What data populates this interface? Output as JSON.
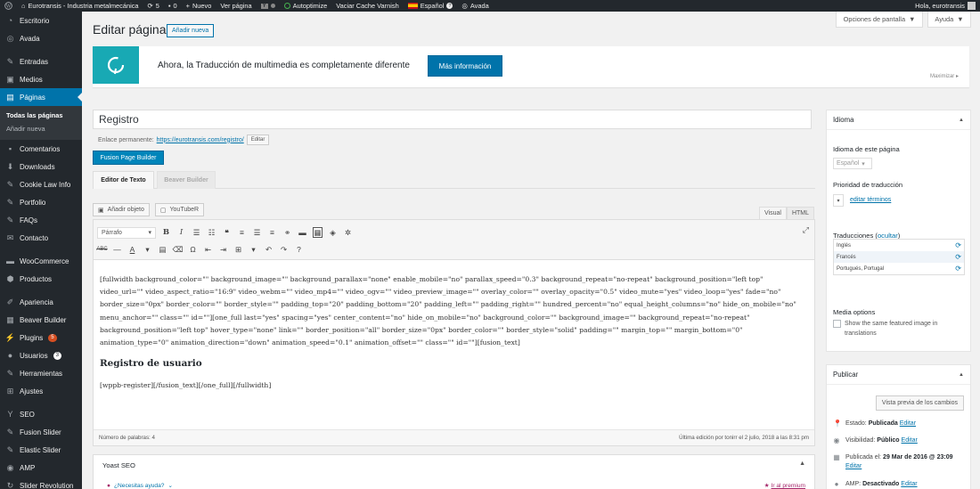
{
  "admin_bar": {
    "site_name": "Eurotransis - Industria metalmecánica",
    "updates_count": "5",
    "comments_count": "0",
    "new_label": "Nuevo",
    "view_page_label": "Ver página",
    "autoptimize_label": "Autoptimize",
    "varnish_label": "Vaciar Cache Varnish",
    "language_label": "Español",
    "avada_label": "Avada",
    "greeting": "Hola, eurotransis"
  },
  "sidebar": {
    "items": [
      {
        "label": "Escritorio",
        "icon": "dashboard-icon"
      },
      {
        "label": "Avada",
        "icon": "avada-icon"
      },
      {
        "label": "Entradas",
        "icon": "pin-icon"
      },
      {
        "label": "Medios",
        "icon": "media-icon"
      },
      {
        "label": "Páginas",
        "icon": "pages-icon"
      },
      {
        "label": "Comentarios",
        "icon": "comment-icon"
      },
      {
        "label": "Downloads",
        "icon": "download-icon"
      },
      {
        "label": "Cookie Law Info",
        "icon": "pin-icon"
      },
      {
        "label": "Portfolio",
        "icon": "pin-icon"
      },
      {
        "label": "FAQs",
        "icon": "pin-icon"
      },
      {
        "label": "Contacto",
        "icon": "mail-icon"
      },
      {
        "label": "WooCommerce",
        "icon": "woo-icon"
      },
      {
        "label": "Productos",
        "icon": "box-icon"
      },
      {
        "label": "Apariencia",
        "icon": "brush-icon"
      },
      {
        "label": "Beaver Builder",
        "icon": "layout-icon"
      },
      {
        "label": "Plugins",
        "icon": "plugin-icon",
        "badge": "5"
      },
      {
        "label": "Usuarios",
        "icon": "user-icon",
        "badge": "3"
      },
      {
        "label": "Herramientas",
        "icon": "wrench-icon"
      },
      {
        "label": "Ajustes",
        "icon": "settings-icon"
      },
      {
        "label": "SEO",
        "icon": "seo-icon"
      },
      {
        "label": "Fusion Slider",
        "icon": "pin-icon"
      },
      {
        "label": "Elastic Slider",
        "icon": "pin-icon"
      },
      {
        "label": "AMP",
        "icon": "amp-icon"
      },
      {
        "label": "Slider Revolution",
        "icon": "slider-icon"
      }
    ],
    "submenu": [
      "Todas las páginas",
      "Añadir nueva"
    ]
  },
  "screen_options": {
    "options_label": "Opciones de pantalla",
    "help_label": "Ayuda"
  },
  "header": {
    "title": "Editar página",
    "add_new_label": "Añadir nueva"
  },
  "notice": {
    "text": "Ahora, la Traducción de multimedia es completamente diferente",
    "button": "Más información",
    "minimize": "Maximizar"
  },
  "editor": {
    "post_title": "Registro",
    "permalink_label": "Enlace permanente:",
    "permalink_url": "https://eurotransis.com/registro/",
    "edit_label": "Editar",
    "fusion_builder_label": "Fusion Page Builder",
    "tab_text_editor": "Editor de Texto",
    "tab_beaver": "Beaver Builder",
    "add_media_label": "Añadir objeto",
    "youtube_label": "YouTubeR",
    "visual_tab": "Visual",
    "html_tab": "HTML",
    "format_select": "Párrafo",
    "content_shortcode_1": "[fullwidth background_color=\"\" background_image=\"\" background_parallax=\"none\" enable_mobile=\"no\" parallax_speed=\"0.3\" background_repeat=\"no-repeat\" background_position=\"left top\" video_url=\"\" video_aspect_ratio=\"16:9\" video_webm=\"\" video_mp4=\"\" video_ogv=\"\" video_preview_image=\"\" overlay_color=\"\" overlay_opacity=\"0.5\" video_mute=\"yes\" video_loop=\"yes\" fade=\"no\" border_size=\"0px\" border_color=\"\" border_style=\"\" padding_top=\"20\" padding_bottom=\"20\" padding_left=\"\" padding_right=\"\" hundred_percent=\"no\" equal_height_columns=\"no\" hide_on_mobile=\"no\" menu_anchor=\"\" class=\"\" id=\"\"][one_full last=\"yes\" spacing=\"yes\" center_content=\"no\" hide_on_mobile=\"no\" background_color=\"\" background_image=\"\" background_repeat=\"no-repeat\" background_position=\"left top\" hover_type=\"none\" link=\"\" border_position=\"all\" border_size=\"0px\" border_color=\"\" border_style=\"solid\" padding=\"\" margin_top=\"\" margin_bottom=\"0\" animation_type=\"0\" animation_direction=\"down\" animation_speed=\"0.1\" animation_offset=\"\" class=\"\" id=\"\"][fusion_text]",
    "content_heading": "Registro de usuario",
    "content_shortcode_2": "[wppb-register][/fusion_text][/one_full][/fullwidth]",
    "word_count": "Número de palabras: 4",
    "last_edit": "Última edición por tonirr el 2 julio, 2018 a las 8:31 pm"
  },
  "yoast": {
    "title": "Yoast SEO",
    "help_label": "¿Necesitas ayuda?",
    "premium_label": "Ir al premium"
  },
  "language_box": {
    "title": "Idioma",
    "page_language_label": "Idioma de este página",
    "language_value": "Español",
    "priority_label": "Prioridad de traducción",
    "edit_terms_link": "editar términos",
    "translations_label": "Traducciones",
    "hide_link": "ocultar",
    "translations": [
      "Inglés",
      "Francés",
      "Portugués, Portugal"
    ],
    "media_options_label": "Media options",
    "media_checkbox_label": "Show the same featured image in translations"
  },
  "publish_box": {
    "title": "Publicar",
    "preview_label": "Vista previa de los cambios",
    "status_label": "Estado:",
    "status_value": "Publicada",
    "visibility_label": "Visibilidad:",
    "visibility_value": "Público",
    "published_label": "Publicada el:",
    "published_value": "29 Mar de 2016 @ 23:09",
    "amp_label": "AMP:",
    "amp_value": "Desactivado",
    "edit_label": "Editar"
  },
  "colors": {
    "admin_dark": "#23282d",
    "accent_blue": "#0073aa",
    "notice_teal": "#18a9b4"
  }
}
